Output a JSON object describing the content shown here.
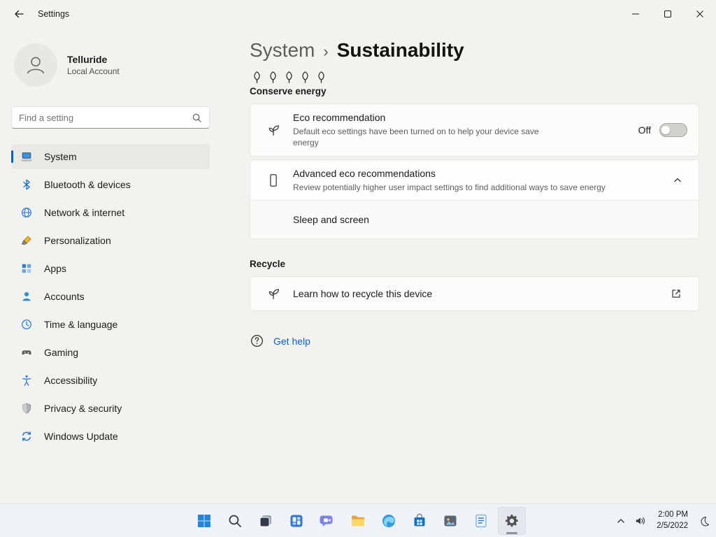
{
  "colors": {
    "accent": "#0067c0",
    "taskbar_bg": "#eff3f8",
    "card_bg": "#fbfbfa"
  },
  "titlebar": {
    "title": "Settings"
  },
  "sidebar": {
    "user": {
      "name": "Telluride",
      "type": "Local Account"
    },
    "search_placeholder": "Find a setting",
    "items": [
      {
        "label": "System"
      },
      {
        "label": "Bluetooth & devices"
      },
      {
        "label": "Network & internet"
      },
      {
        "label": "Personalization"
      },
      {
        "label": "Apps"
      },
      {
        "label": "Accounts"
      },
      {
        "label": "Time & language"
      },
      {
        "label": "Gaming"
      },
      {
        "label": "Accessibility"
      },
      {
        "label": "Privacy & security"
      },
      {
        "label": "Windows Update"
      }
    ]
  },
  "main": {
    "breadcrumb": {
      "parent": "System",
      "separator": "›",
      "current": "Sustainability"
    },
    "conserve_label": "Conserve energy",
    "eco": {
      "title": "Eco recommendation",
      "desc": "Default eco settings have been turned on to help your device save energy",
      "state": "Off"
    },
    "advanced": {
      "title": "Advanced eco recommendations",
      "desc": "Review potentially higher user impact settings to find additional ways to save energy",
      "sub": "Sleep and screen"
    },
    "recycle_heading": "Recycle",
    "recycle": {
      "title": "Learn how to recycle this device"
    },
    "get_help": "Get help"
  },
  "taskbar": {
    "time": "2:00 PM",
    "date": "2/5/2022"
  }
}
